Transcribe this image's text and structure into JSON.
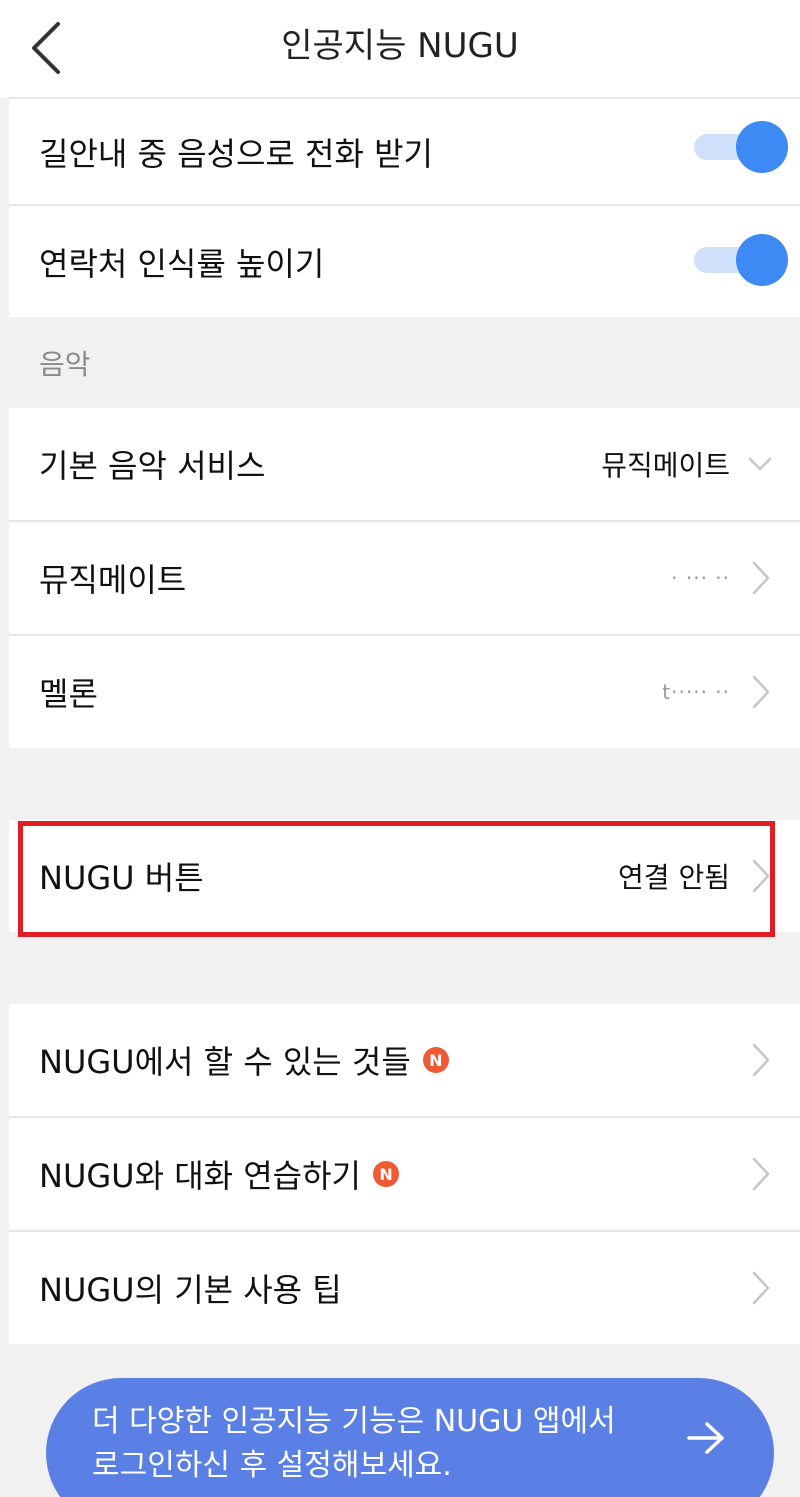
{
  "header": {
    "title": "인공지능 NUGU",
    "back_icon": "chevron-left-icon"
  },
  "navigation_section": {
    "items": [
      {
        "label": "길안내 중 음성으로 전화 받기",
        "toggle": "on"
      },
      {
        "label": "연락처 인식률 높이기",
        "toggle": "on"
      }
    ]
  },
  "music_section": {
    "title": "음악",
    "default_service": {
      "label": "기본 음악 서비스",
      "value": "뮤직메이트"
    },
    "musicmate": {
      "label": "뮤직메이트",
      "value": "· ··· ··"
    },
    "melon": {
      "label": "멜론",
      "value": "t·····  ··"
    }
  },
  "nugu_button": {
    "label": "NUGU 버튼",
    "value": "연결 안됨"
  },
  "info_section": {
    "items": [
      {
        "label": "NUGU에서 할 수 있는 것들",
        "badge": "N"
      },
      {
        "label": "NUGU와 대화 연습하기",
        "badge": "N"
      },
      {
        "label": "NUGU의 기본 사용 팁"
      }
    ]
  },
  "banner": {
    "text": "더 다양한 인공지능 기능은 NUGU 앱에서 로그인하신 후 설정해보세요."
  },
  "colors": {
    "accent": "#3d8af4",
    "badge": "#ef5a33",
    "highlight": "#e01c24",
    "banner": "#5a80e6"
  }
}
